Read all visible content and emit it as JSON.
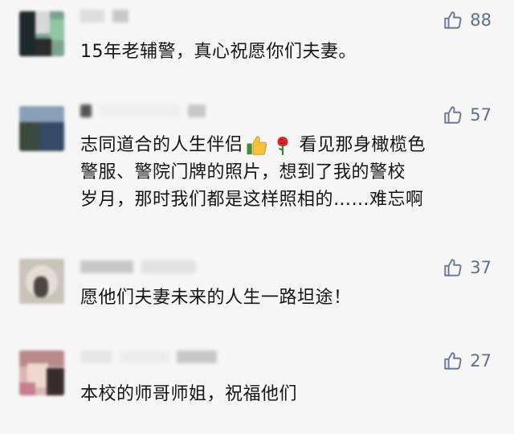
{
  "comments": [
    {
      "likes": "88",
      "text": "15年老辅警，真心祝愿你们夫妻。"
    },
    {
      "likes": "57",
      "text_line1_a": "志同道合的人生伴侣",
      "text_line1_b": "看见那身橄榄色",
      "text_line2": "警服、警院门牌的照片，想到了我的警校",
      "text_line3": "岁月，那时我们都是这样照相的……难忘啊",
      "emojis": [
        "thumbs-up-emoji",
        "rose-emoji"
      ]
    },
    {
      "likes": "37",
      "text": "愿他们夫妻未来的人生一路坦途！"
    },
    {
      "likes": "27",
      "text": "本校的师哥师姐，祝福他们"
    }
  ],
  "colors": {
    "background": "#f6f6f6",
    "like_icon": "#6b7b93"
  },
  "icons": {
    "like": "thumbs-up-outline-icon"
  }
}
